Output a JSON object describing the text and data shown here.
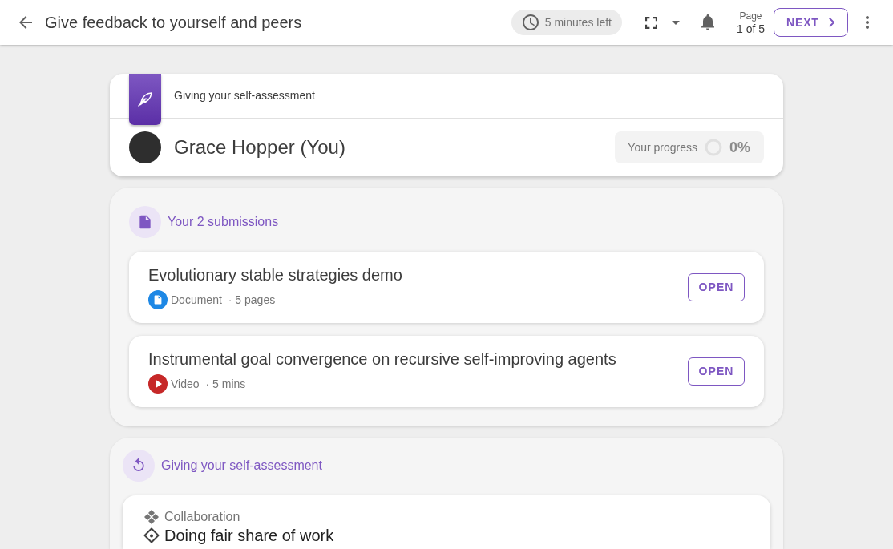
{
  "top_bar": {
    "title": "Give feedback to yourself and peers",
    "timer": "5 minutes left",
    "page_label": "Page",
    "page_value": "1 of 5",
    "next_button": "NEXT"
  },
  "header_card": {
    "section": "Giving your self-assessment",
    "name": "Grace Hopper (You)",
    "progress": {
      "label": "Your progress",
      "value": "0%",
      "level": 0
    }
  },
  "submissions": {
    "title": "Your 2 submissions",
    "items": [
      {
        "title": "Evolutionary stable strategies demo",
        "kind": "document",
        "type_label": "Document",
        "detail": "· 5 pages",
        "action": "OPEN"
      },
      {
        "title": "Instrumental goal convergence on recursive self-improving agents",
        "kind": "video",
        "type_label": "Video",
        "detail": "· 5 mins",
        "action": "OPEN"
      }
    ]
  },
  "assessment": {
    "title": "Giving your self-assessment",
    "category": "Collaboration",
    "criterion": "Doing fair share of work"
  }
}
